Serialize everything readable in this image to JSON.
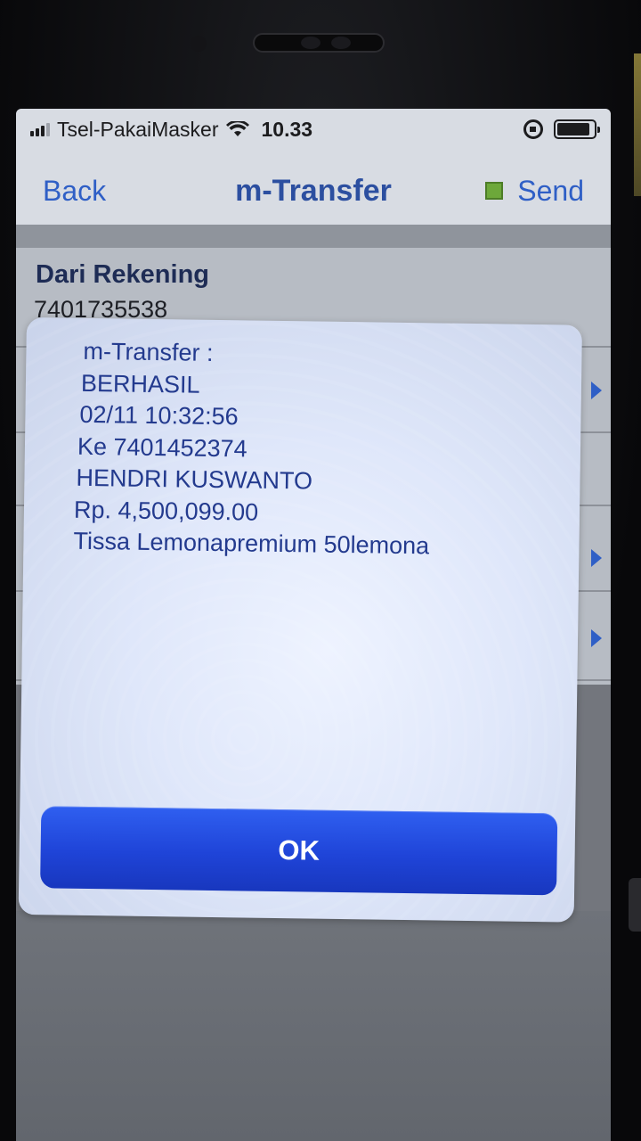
{
  "status_bar": {
    "carrier": "Tsel-PakaiMasker",
    "time": "10.33",
    "signal_bars": 4,
    "signal_active": 3,
    "battery_level": 0.9,
    "icons": [
      "signal-icon",
      "wifi-icon",
      "rotation-lock-icon",
      "battery-icon"
    ]
  },
  "navbar": {
    "back_label": "Back",
    "title": "m-Transfer",
    "send_label": "Send",
    "send_indicator_color": "#6da83a"
  },
  "form": {
    "from_account_label": "Dari Rekening",
    "from_account_value": "7401735538"
  },
  "dialog": {
    "lines": [
      "m-Transfer :",
      "BERHASIL",
      "02/11 10:32:56",
      "Ke 7401452374",
      "HENDRI KUSWANTO",
      "Rp. 4,500,099.00",
      "Tissa Lemonapremium 50lemona"
    ],
    "ok_label": "OK"
  },
  "colors": {
    "accent": "#2f5fc6",
    "dialog_text": "#233a8e",
    "ok_button": "#1f44d8"
  }
}
